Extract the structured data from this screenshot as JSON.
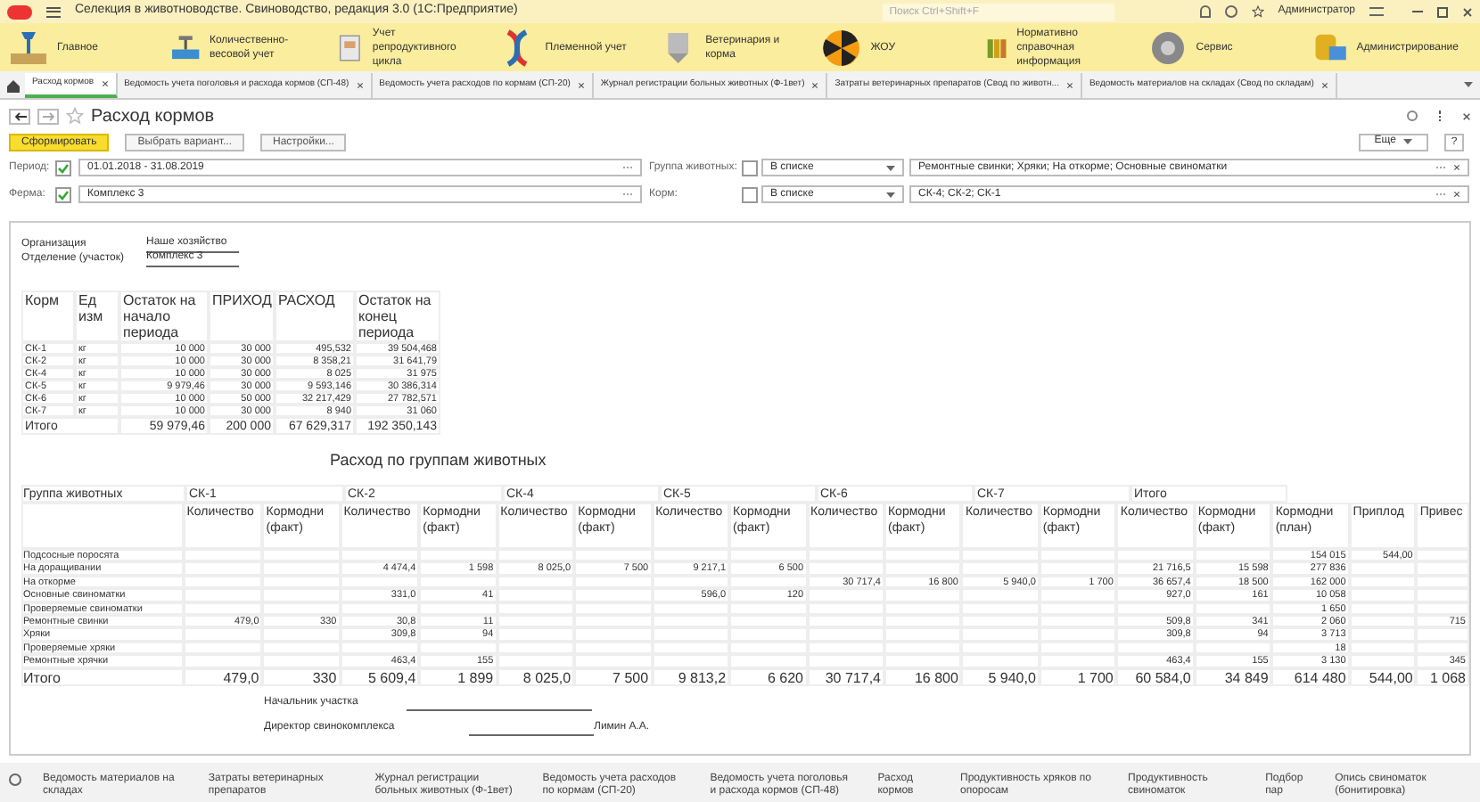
{
  "app": {
    "title": "Селекция в животноводстве. Свиноводство, редакция 3.0  (1С:Предприятие)",
    "search_placeholder": "Поиск Ctrl+Shift+F",
    "user": "Администратор"
  },
  "sections": [
    "Главное",
    "Количественно-весовой учет",
    "Учет репродуктивного цикла",
    "Племенной учет",
    "Ветеринария и корма",
    "ЖОУ",
    "Нормативно справочная информация",
    "Сервис",
    "Администрирование"
  ],
  "tabs": [
    {
      "label": "Расход кормов",
      "selected": true
    },
    {
      "label": "Ведомость учета поголовья и расхода кормов (СП-48)",
      "selected": false
    },
    {
      "label": "Ведомость учета расходов по кормам (СП-20)",
      "selected": false
    },
    {
      "label": "Журнал регистрации больных животных (Ф-1вет)",
      "selected": false
    },
    {
      "label": "Затраты ветеринарных препаратов (Свод по животн...",
      "selected": false
    },
    {
      "label": "Ведомость материалов на складах (Свод по складам)",
      "selected": false
    }
  ],
  "form": {
    "title": "Расход кормов",
    "buttons": [
      "Сформировать",
      "Выбрать вариант...",
      "Настройки..."
    ],
    "more": "Еще",
    "help": "?",
    "filters": [
      {
        "label": "Период:",
        "checked": true,
        "value": "01.01.2018 - 31.08.2019",
        "label2": "Группа животных:",
        "checked2": false,
        "mode": "В списке",
        "value2": "Ремонтные свинки; Хряки; На откорме; Основные свиноматки"
      },
      {
        "label": "Ферма:",
        "checked": true,
        "value": "Комплекс 3",
        "label2": "Корм:",
        "checked2": false,
        "mode": "В списке",
        "value2": "СК-4; СК-2; СК-1"
      }
    ]
  },
  "report": {
    "header": [
      {
        "label": "Организация",
        "value": "Наше хозяйство"
      },
      {
        "label": "Отделение (участок)",
        "value": "Комплекс 3"
      }
    ],
    "summary_columns": [
      "Корм",
      "Ед изм",
      "Остаток на начало периода",
      "ПРИХОД",
      "РАСХОД",
      "Остаток на конец периода"
    ],
    "summary_rows": [
      [
        "СК-1",
        "кг",
        "10 000",
        "30 000",
        "495,532",
        "39 504,468"
      ],
      [
        "СК-2",
        "кг",
        "10 000",
        "30 000",
        "8 358,21",
        "31 641,79"
      ],
      [
        "СК-4",
        "кг",
        "10 000",
        "30 000",
        "8 025",
        "31 975"
      ],
      [
        "СК-5",
        "кг",
        "9 979,46",
        "30 000",
        "9 593,146",
        "30 386,314"
      ],
      [
        "СК-6",
        "кг",
        "10 000",
        "50 000",
        "32 217,429",
        "27 782,571"
      ],
      [
        "СК-7",
        "кг",
        "10 000",
        "30 000",
        "8 940",
        "31 060"
      ]
    ],
    "summary_total": [
      "Итого",
      "59 979,46",
      "200 000",
      "67 629,317",
      "192 350,143"
    ],
    "groups_title": "Расход по группам животных",
    "group_header": "Группа животных",
    "feeds": [
      "СК-1",
      "СК-2",
      "СК-4",
      "СК-5",
      "СК-6",
      "СК-7",
      "Итого"
    ],
    "subcolumns": [
      "Количество",
      "Кормодни (факт)",
      "Количество",
      "Кормодни (факт)",
      "Количество",
      "Кормодни (факт)",
      "Количество",
      "Кормодни (факт)",
      "Количество",
      "Кормодни (факт)",
      "Количество",
      "Кормодни (факт)",
      "Количество",
      "Кормодни (факт)",
      "Кормодни (план)",
      "Приплод",
      "Привес"
    ],
    "group_rows": [
      {
        "name": "Подсосные поросята",
        "cells": [
          "",
          "",
          "",
          "",
          "",
          "",
          "",
          "",
          "",
          "",
          "",
          "",
          "",
          "",
          "154 015",
          "544,00",
          ""
        ]
      },
      {
        "name": "На доращивании",
        "cells": [
          "",
          "",
          "4 474,4",
          "1 598",
          "8 025,0",
          "7 500",
          "9 217,1",
          "6 500",
          "",
          "",
          "",
          "",
          "21 716,5",
          "15 598",
          "277 836",
          "",
          ""
        ]
      },
      {
        "name": "На откорме",
        "cells": [
          "",
          "",
          "",
          "",
          "",
          "",
          "",
          "",
          "30 717,4",
          "16 800",
          "5 940,0",
          "1 700",
          "36 657,4",
          "18 500",
          "162 000",
          "",
          ""
        ]
      },
      {
        "name": "Основные свиноматки",
        "cells": [
          "",
          "",
          "331,0",
          "41",
          "",
          "",
          "596,0",
          "120",
          "",
          "",
          "",
          "",
          "927,0",
          "161",
          "10 058",
          "",
          ""
        ]
      },
      {
        "name": "Проверяемые свиноматки",
        "cells": [
          "",
          "",
          "",
          "",
          "",
          "",
          "",
          "",
          "",
          "",
          "",
          "",
          "",
          "",
          "1 650",
          "",
          ""
        ]
      },
      {
        "name": "Ремонтные свинки",
        "cells": [
          "479,0",
          "330",
          "30,8",
          "11",
          "",
          "",
          "",
          "",
          "",
          "",
          "",
          "",
          "509,8",
          "341",
          "2 060",
          "",
          "715"
        ]
      },
      {
        "name": "Хряки",
        "cells": [
          "",
          "",
          "309,8",
          "94",
          "",
          "",
          "",
          "",
          "",
          "",
          "",
          "",
          "309,8",
          "94",
          "3 713",
          "",
          ""
        ]
      },
      {
        "name": "Проверяемые хряки",
        "cells": [
          "",
          "",
          "",
          "",
          "",
          "",
          "",
          "",
          "",
          "",
          "",
          "",
          "",
          "",
          "18",
          "",
          ""
        ]
      },
      {
        "name": "Ремонтные хрячки",
        "cells": [
          "",
          "",
          "463,4",
          "155",
          "",
          "",
          "",
          "",
          "",
          "",
          "",
          "",
          "463,4",
          "155",
          "3 130",
          "",
          "345"
        ]
      }
    ],
    "group_total": {
      "name": "Итого",
      "cells": [
        "479,0",
        "330",
        "5 609,4",
        "1 899",
        "8 025,0",
        "7 500",
        "9 813,2",
        "6 620",
        "30 717,4",
        "16 800",
        "5 940,0",
        "1 700",
        "60 584,0",
        "34 849",
        "614 480",
        "544,00",
        "1 068"
      ]
    },
    "signatures": [
      {
        "label": "Начальник участка"
      },
      {
        "label": "Директор свинокомплекса",
        "name": "Лимин А.А."
      }
    ]
  },
  "history": [
    "Ведомость материалов на складах",
    "Затраты ветеринарных препаратов",
    "Журнал регистрации больных животных (Ф-1вет)",
    "Ведомость учета расходов по кормам (СП-20)",
    "Ведомость учета поголовья и расхода кормов (СП-48)",
    "Расход кормов",
    "Продуктивность хряков по опоросам",
    "Продуктивность свиноматок",
    "Подбор пар",
    "Опись свиноматок (бонитировка)"
  ]
}
